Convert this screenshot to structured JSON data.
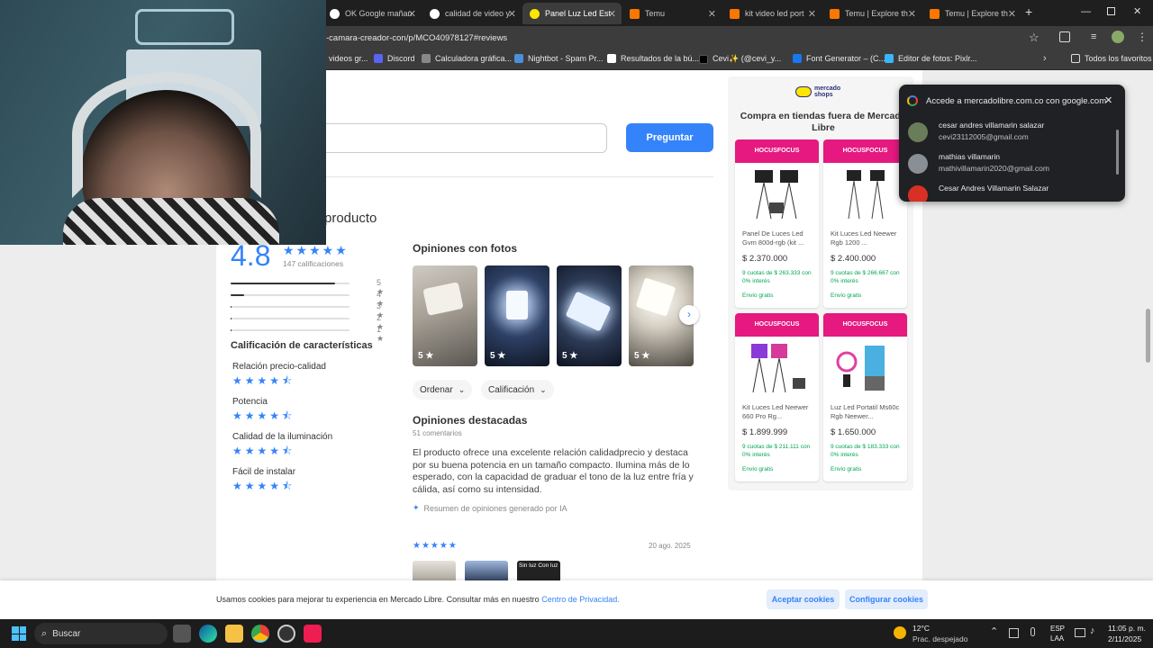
{
  "browser": {
    "tabs": [
      {
        "label": "OK Google mañan",
        "color": "#ffffff"
      },
      {
        "label": "calidad de video y",
        "color": "#ffffff"
      },
      {
        "label": "Panel Luz Led Est",
        "color": "#ffe600"
      },
      {
        "label": "Temu",
        "color": "#fb7701"
      },
      {
        "label": "kit video led port",
        "color": "#fb7701"
      },
      {
        "label": "Temu | Explore th",
        "color": "#fb7701"
      },
      {
        "label": "Temu | Explore th",
        "color": "#fb7701"
      }
    ],
    "new_tab": "+",
    "url": "-camara-creador-con/p/MCO40978127#reviews",
    "bookmarks": [
      {
        "label": "videos gr...",
        "color": "#e74c3c"
      },
      {
        "label": "Discord",
        "color": "#5865f2"
      },
      {
        "label": "Calculadora gráfica...",
        "color": "#888888"
      },
      {
        "label": "Nightbot - Spam Pr...",
        "color": "#4a90d9"
      },
      {
        "label": "Resultados de la bú...",
        "color": "#ffffff"
      },
      {
        "label": "Cevi✨ (@cevi_y...",
        "color": "#000000"
      },
      {
        "label": "Font Generator – (C...",
        "color": "#1877f2"
      },
      {
        "label": "Editor de fotos: Pixlr...",
        "color": "#38b6ff"
      }
    ],
    "bookmarks_all": "Todos los favoritos"
  },
  "questions": {
    "ask_button": "Preguntar"
  },
  "reviews": {
    "title": "producto",
    "rating": "4.8",
    "rating_stars": "★★★★★",
    "rating_count": "147 calificaciones",
    "distribution": [
      {
        "star": "5",
        "fraction": 0.88
      },
      {
        "star": "4",
        "fraction": 0.11
      },
      {
        "star": "3",
        "fraction": 0.01
      },
      {
        "star": "2",
        "fraction": 0.01
      },
      {
        "star": "1",
        "fraction": 0.01
      }
    ],
    "features_title": "Calificación de características",
    "features": [
      {
        "label": "Relación precio-calidad",
        "stars": "★★★★⯪"
      },
      {
        "label": "Potencia",
        "stars": "★★★★⯪"
      },
      {
        "label": "Calidad de la iluminación",
        "stars": "★★★★⯪"
      },
      {
        "label": "Fácil de instalar",
        "stars": "★★★★⯪"
      }
    ],
    "photos_title": "Opiniones con fotos",
    "photos": [
      {
        "rating": "5 ★"
      },
      {
        "rating": "5 ★"
      },
      {
        "rating": "5 ★"
      },
      {
        "rating": "5 ★"
      }
    ],
    "sort_label": "Ordenar",
    "filter_label": "Calificación",
    "featured_title": "Opiniones destacadas",
    "featured_count": "51 comentarios",
    "summary": "El producto ofrece una excelente relación calidadprecio y destaca por su buena potencia en un tamaño compacto. Ilumina más de lo esperado, con la capacidad de graduar el tono de la luz entre fría y cálida, así como su intensidad.",
    "ai_note": "Resumen de opiniones generado por IA",
    "first_review_stars": "★★★★★",
    "first_review_date": "20 ago. 2025",
    "first_review_photo_text": "Sin luz  Con luz"
  },
  "sidebar": {
    "logo": "mercado shops",
    "title": "Compra en tiendas fuera de Mercado Libre",
    "products": [
      {
        "seller": "HOCUSFOCUS",
        "name": "Panel De Luces Led Gvm 800d-rgb (kit ...",
        "price": "$ 2.370.000",
        "cuotas": "9 cuotas de $ 263.333 con 0% interés",
        "envio": "Envío gratis"
      },
      {
        "seller": "HOCUSFOCUS",
        "name": "Kit Luces Led Neewer Rgb 1200 ...",
        "price": "$ 2.400.000",
        "cuotas": "9 cuotas de $ 266.667 con 0% interés",
        "envio": "Envío gratis"
      },
      {
        "seller": "HOCUSFOCUS",
        "name": "Kit Luces Led Neewer 660 Pro Rg...",
        "price": "$ 1.899.999",
        "cuotas": "9 cuotas de $ 211.111 con 0% interés",
        "envio": "Envío gratis"
      },
      {
        "seller": "HOCUSFOCUS",
        "name": "Luz Led Portatil Ms60c Rgb Neewer...",
        "price": "$ 1.650.000",
        "cuotas": "9 cuotas de $ 183.333 con 0% interés",
        "envio": "Envío gratis"
      }
    ]
  },
  "google_popup": {
    "title": "Accede a mercadolibre.com.co con google.com",
    "accounts": [
      {
        "name": "cesar andres villamarin salazar",
        "email": "cevi23112005@gmail.com"
      },
      {
        "name": "mathias villamarin",
        "email": "mathivillamarin2020@gmail.com"
      },
      {
        "name": "Cesar Andres Villamarin Salazar",
        "email": ""
      }
    ]
  },
  "cookie_bar": {
    "text": "Usamos cookies para mejorar tu experiencia en Mercado Libre. Consultar más en nuestro",
    "link": "Centro de Privacidad.",
    "accept": "Aceptar cookies",
    "configure": "Configurar cookies"
  },
  "taskbar": {
    "search": "Buscar",
    "weather_temp": "12°C",
    "weather_desc": "Prac. despejado",
    "lang": "ESP",
    "lang2": "LAA",
    "time": "11:05 p. m.",
    "date": "2/11/2025"
  }
}
